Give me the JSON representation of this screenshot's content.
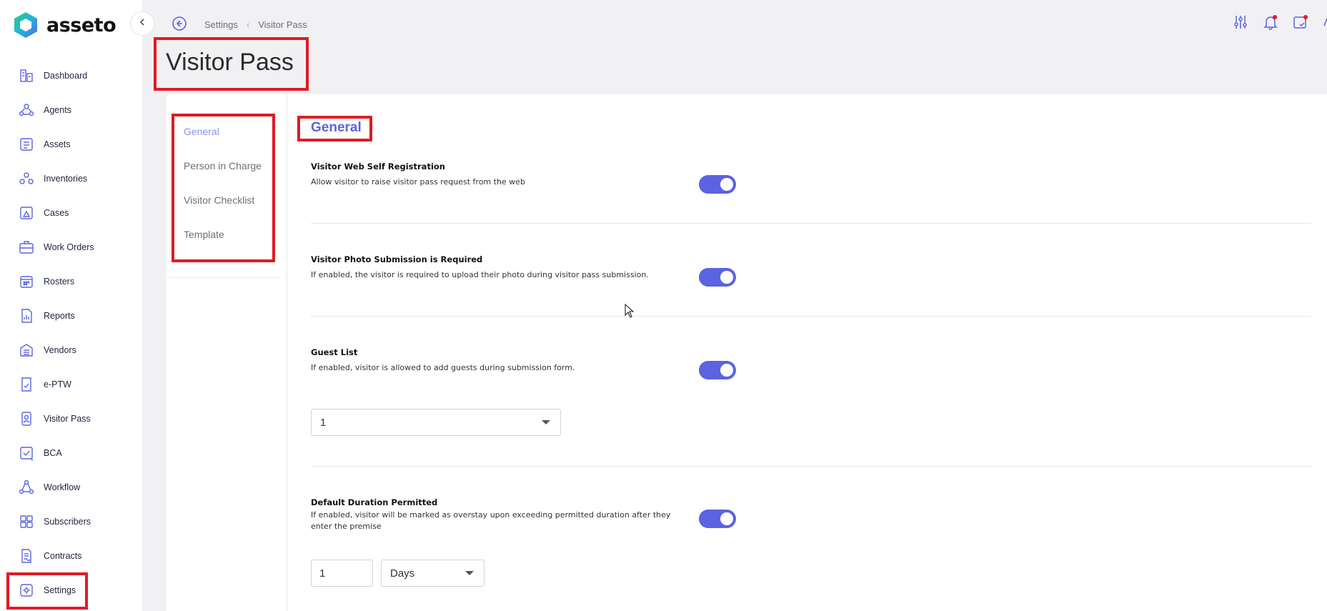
{
  "app": {
    "brand": "asseto",
    "accent": "#5b63e0"
  },
  "sidebar": {
    "items": [
      {
        "label": "Dashboard",
        "icon": "dashboard-icon"
      },
      {
        "label": "Agents",
        "icon": "agents-icon"
      },
      {
        "label": "Assets",
        "icon": "assets-icon"
      },
      {
        "label": "Inventories",
        "icon": "inventories-icon"
      },
      {
        "label": "Cases",
        "icon": "cases-icon"
      },
      {
        "label": "Work Orders",
        "icon": "work-orders-icon"
      },
      {
        "label": "Rosters",
        "icon": "rosters-icon"
      },
      {
        "label": "Reports",
        "icon": "reports-icon"
      },
      {
        "label": "Vendors",
        "icon": "vendors-icon"
      },
      {
        "label": "e-PTW",
        "icon": "eptw-icon"
      },
      {
        "label": "Visitor Pass",
        "icon": "visitor-pass-icon"
      },
      {
        "label": "BCA",
        "icon": "bca-icon"
      },
      {
        "label": "Workflow",
        "icon": "workflow-icon"
      },
      {
        "label": "Subscribers",
        "icon": "subscribers-icon"
      },
      {
        "label": "Contracts",
        "icon": "contracts-icon"
      },
      {
        "label": "Settings",
        "icon": "settings-icon"
      }
    ],
    "active": "Settings"
  },
  "breadcrumb": {
    "parent": "Settings",
    "current": "Visitor Pass"
  },
  "page": {
    "title": "Visitor Pass"
  },
  "subnav": {
    "items": [
      "General",
      "Person in Charge",
      "Visitor Checklist",
      "Template"
    ],
    "active": "General"
  },
  "general": {
    "title": "General",
    "settings": {
      "web_self_registration": {
        "title": "Visitor Web Self Registration",
        "description": "Allow visitor to raise visitor pass request from the web",
        "enabled": true
      },
      "photo_required": {
        "title": "Visitor Photo Submission is Required",
        "description": "If enabled, the visitor is required to upload their photo during visitor pass submission.",
        "enabled": true
      },
      "guest_list": {
        "title": "Guest List",
        "description": "If enabled, visitor is allowed to add guests during submission form.",
        "enabled": true,
        "select_value": "1"
      },
      "default_duration": {
        "title": "Default Duration Permitted",
        "description": "If enabled, visitor will be marked as overstay upon exceeding permitted duration after they enter the premise",
        "enabled": true,
        "number_value": "1",
        "unit_value": "Days"
      }
    }
  }
}
